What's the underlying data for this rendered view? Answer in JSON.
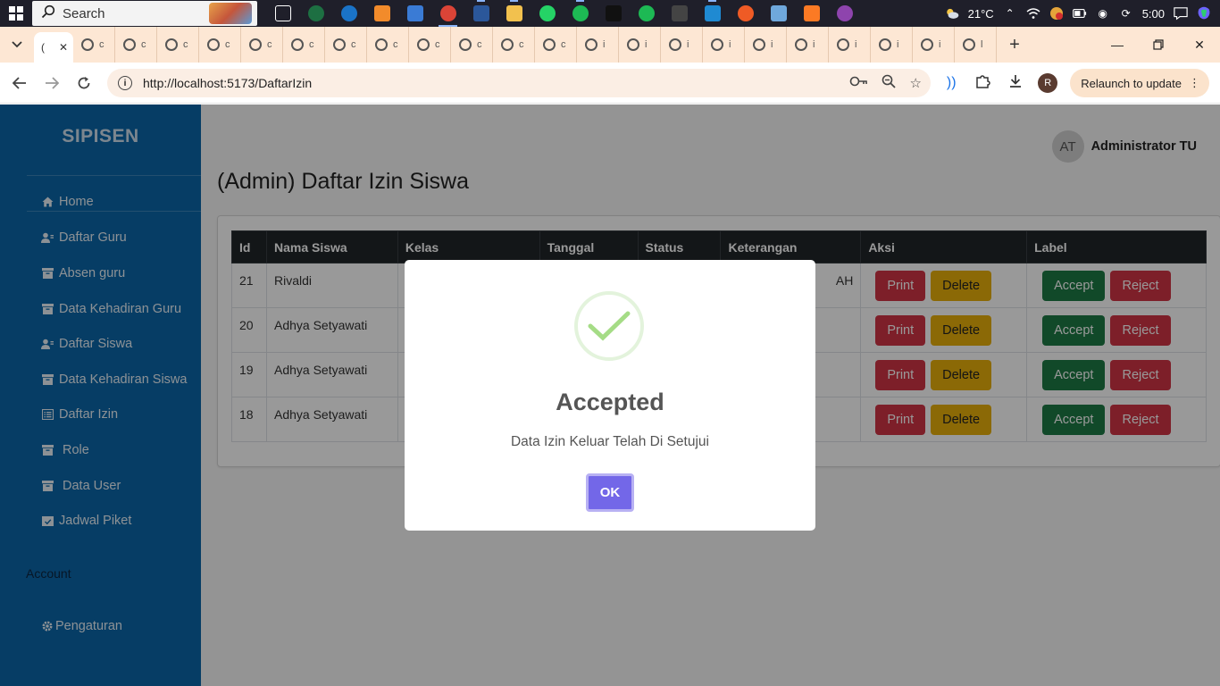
{
  "taskbar": {
    "search_label": "Search",
    "weather_temp": "21°C",
    "clock": "5:00",
    "apps": [
      {
        "icon": "task-view-icon",
        "color": "#1f1f2a"
      },
      {
        "icon": "excel-icon",
        "color": "#1d6f42"
      },
      {
        "icon": "edge-icon",
        "color": "#1a73c7"
      },
      {
        "icon": "sublime-icon",
        "color": "#f28b2b"
      },
      {
        "icon": "store-icon",
        "color": "#3a7bd5"
      },
      {
        "icon": "chrome-icon",
        "color": "#db4437"
      },
      {
        "icon": "word-icon",
        "color": "#2b579a"
      },
      {
        "icon": "file-explorer-icon",
        "color": "#f2c14e"
      },
      {
        "icon": "whatsapp-icon",
        "color": "#25d366"
      },
      {
        "icon": "spotify-icon",
        "color": "#1db954"
      },
      {
        "icon": "tiktok-icon",
        "color": "#111111"
      },
      {
        "icon": "spotify-icon",
        "color": "#1db954"
      },
      {
        "icon": "terminal-icon",
        "color": "#444444"
      },
      {
        "icon": "vscode-icon",
        "color": "#1f8ad2"
      },
      {
        "icon": "postman-icon",
        "color": "#ef5b25"
      },
      {
        "icon": "notepad-icon",
        "color": "#6fa8dc"
      },
      {
        "icon": "xampp-icon",
        "color": "#fb7a24"
      },
      {
        "icon": "browser-icon",
        "color": "#8e44ad"
      }
    ]
  },
  "browser": {
    "tab_menu_icon": "chevron-down-icon",
    "active_tab_label": "(",
    "mini_tabs": [
      "c",
      "c",
      "c",
      "c",
      "c",
      "c",
      "c",
      "c",
      "c",
      "c",
      "c",
      "c",
      "i",
      "i",
      "i",
      "i",
      "i",
      "i",
      "i",
      "i",
      "i",
      "l"
    ],
    "url": "http://localhost:5173/DaftarIzin",
    "relaunch_label": "Relaunch to update",
    "profile_initial": "R"
  },
  "app": {
    "brand": "SIPISEN",
    "menu": [
      {
        "label": "Home",
        "icon": "home-icon"
      },
      {
        "label": "Daftar Guru",
        "icon": "users-icon"
      },
      {
        "label": "Absen guru",
        "icon": "archive-icon"
      },
      {
        "label": "Data Kehadiran Guru",
        "icon": "archive-icon"
      },
      {
        "label": "Daftar Siswa",
        "icon": "users-icon"
      },
      {
        "label": "Data Kehadiran Siswa",
        "icon": "archive-icon"
      },
      {
        "label": "Daftar Izin",
        "icon": "list-icon"
      },
      {
        "label": "Role",
        "icon": "archive-icon"
      },
      {
        "label": "Data User",
        "icon": "archive-icon"
      },
      {
        "label": "Jadwal Piket",
        "icon": "calendar-check-icon"
      }
    ],
    "account_label": "Account",
    "settings_label": "Pengaturan",
    "user": {
      "initials": "AT",
      "name": "Administrator TU"
    },
    "page_title": "(Admin) Daftar Izin Siswa",
    "table": {
      "headers": [
        "Id",
        "Nama Siswa",
        "Kelas",
        "Tanggal",
        "Status",
        "Keterangan",
        "Aksi",
        "Label"
      ],
      "rows": [
        {
          "id": "21",
          "nama": "Rivaldi",
          "kelas": "",
          "tanggal": "",
          "status": "",
          "keterangan": "AH"
        },
        {
          "id": "20",
          "nama": "Adhya Setyawati",
          "kelas": "",
          "tanggal": "",
          "status": "",
          "keterangan": ""
        },
        {
          "id": "19",
          "nama": "Adhya Setyawati",
          "kelas": "",
          "tanggal": "",
          "status": "",
          "keterangan": ""
        },
        {
          "id": "18",
          "nama": "Adhya Setyawati",
          "kelas": "",
          "tanggal": "",
          "status": "",
          "keterangan": ""
        }
      ],
      "actions": {
        "print": "Print",
        "delete": "Delete",
        "accept": "Accept",
        "reject": "Reject"
      }
    }
  },
  "modal": {
    "title": "Accepted",
    "text": "Data Izin Keluar Telah Di Setujui",
    "ok_label": "OK",
    "icon": "success-check-icon"
  },
  "colors": {
    "sidebar": "#0a66a8",
    "btn_red": "#d03545",
    "btn_yellow": "#e8b00b",
    "btn_green": "#1d7a45",
    "ok": "#7367e8"
  }
}
